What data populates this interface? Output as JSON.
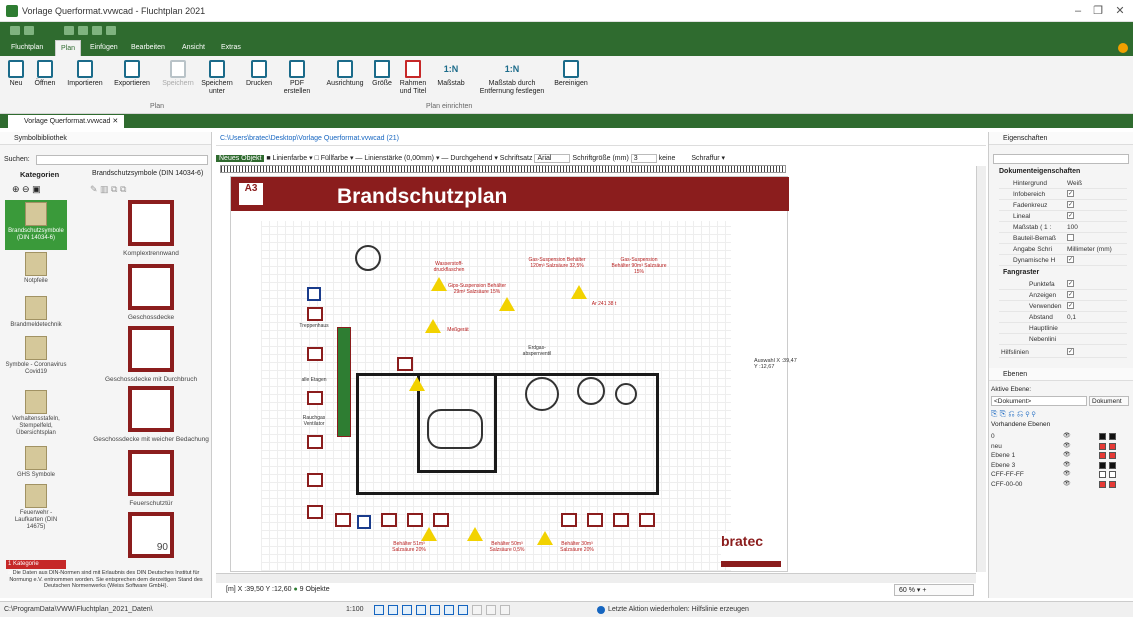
{
  "window": {
    "title": "Vorlage Querformat.vvwcad - Fluchtplan 2021"
  },
  "tabs": [
    "Fluchtplan",
    "Plan",
    "Einfügen",
    "Bearbeiten",
    "Ansicht",
    "Extras"
  ],
  "active_tab": "Plan",
  "ribbon": {
    "buttons": [
      "Neu",
      "Öffnen",
      "Importieren",
      "Exportieren",
      "Speichern",
      "Speichern unter",
      "Drucken",
      "PDF erstellen",
      "Ausrichtung",
      "Größe",
      "Rahmen und Titel",
      "Maßstab",
      "Maßstab durch Entfernung festlegen",
      "Bereinigen"
    ],
    "group_plan": "Plan",
    "group_einrichten": "Plan einrichten",
    "scale_icon": "1:N"
  },
  "doc_tab": "Vorlage Querformat.vvwcad",
  "left_panel": {
    "title": "Symbolbibliothek",
    "search_label": "Suchen:",
    "categories_header": "Kategorien",
    "symbols_header": "Brandschutzsymbole (DIN 14034-6)",
    "categories": [
      "Brandschutzsymbole (DIN 14034-6)",
      "Notpfeile",
      "Brandmeldetechnik",
      "Symbole - Coronavirus Covid19",
      "Verhaltensstafeln, Stempelfeld, Übersichtsplan",
      "GHS Symbole",
      "Feuerwehr - Laufkarten (DIN 14675)"
    ],
    "symbols": [
      "Komplextrennwand",
      "Geschossdecke",
      "Geschossdecke mit Durchbruch",
      "Geschossdecke mit weicher Bedachung",
      "Feuerschutztür",
      "Feuerschutztür"
    ],
    "symbol_last_number": "90",
    "category_note": "1 Kategorie ausgeblen...",
    "footer_note": "Die Daten aus DIN-Normen sind mit Erlaubnis des DIN Deutsches Institut für Normung e.V. entnommen worden. Sie entsprechen dem derzeitigen Stand des Deutschen Normenwerks (Weiss Software GmbH)."
  },
  "canvas": {
    "path": "C:\\Users\\bratec\\Desktop\\Vorlage Querformat.vvwcad (21)",
    "new_object": "Neues Objekt",
    "toolbar_items": [
      "Linienfarbe",
      "Füllfarbe",
      "Linienstärke (0,00mm)",
      "Durchgehend",
      "Schriftsatz",
      "Arial",
      "Schriftgröße (mm)",
      "3",
      "keine",
      "Schraffur"
    ],
    "plan_title": "Brandschutzplan",
    "paper_size": "A3",
    "labels": [
      "Wasserstoff-druckflaschen",
      "Gas-Suspension Behälter 120m³ Salzsäure 32,5%",
      "Gas-Suspension Behälter 90m³ Salzsäure 15%",
      "Gips-Suspension Behälter 29m³ Salzsäure 15%",
      "Ar 241 38 t",
      "Meßgerät",
      "Erdgas-absperrventil",
      "Treppenhaus",
      "alle Etagen",
      "Rauchgas Ventilator",
      "Behälter 51m³ Salzsäure 20%",
      "Behälter 50m³ Salzsäure 0,5%",
      "Behälter 30m³ Salzsäure 20%"
    ],
    "logo": "bratec",
    "side_label": "Auswahl X :39,47 Y :12,67",
    "coordinates": "[m] X :39,50 Y :12,60",
    "objects": "9 Objekte",
    "zoom": "60 %"
  },
  "right_panel": {
    "title": "Eigenschaften",
    "section": "Dokumenteigenschaften",
    "props": [
      {
        "k": "Hintergrund",
        "v": "Weiß"
      },
      {
        "k": "Infobereich",
        "v": "✓"
      },
      {
        "k": "Fadenkreuz",
        "v": "✓"
      },
      {
        "k": "Lineal",
        "v": "✓"
      },
      {
        "k": "Maßstab ( 1 :",
        "v": "100"
      },
      {
        "k": "Bauteil-Bemaß",
        "v": ""
      },
      {
        "k": "Angabe Schri",
        "v": "Millimeter (mm)"
      },
      {
        "k": "Dynamische H",
        "v": "✓"
      }
    ],
    "fangraster": "Fangraster",
    "fang_props": [
      {
        "k": "Punktefa",
        "v": "✓"
      },
      {
        "k": "Anzeigen",
        "v": "✓"
      },
      {
        "k": "Verwenden",
        "v": "✓"
      },
      {
        "k": "Abstand",
        "v": "0,1"
      },
      {
        "k": "Hauptlinie",
        "v": ""
      },
      {
        "k": "Nebenlini",
        "v": ""
      }
    ],
    "hilfslinien": "Hilfslinien",
    "layers_title": "Ebenen",
    "active_layer_label": "Aktive Ebene:",
    "active_layer": "<Dokument>",
    "active_layer_btn": "Dokument",
    "existing_layers": "Vorhandene Ebenen",
    "layers": [
      {
        "name": "0",
        "color": "#111111"
      },
      {
        "name": "neu",
        "color": "#e53935"
      },
      {
        "name": "Ebene 1",
        "color": "#e53935"
      },
      {
        "name": "Ebene 3",
        "color": "#111111"
      },
      {
        "name": "CFF-FF-FF",
        "color": "#ffffff"
      },
      {
        "name": "CFF-00-00",
        "color": "#e53935"
      }
    ]
  },
  "status": {
    "path": "C:\\ProgramData\\VWW\\Fluchtplan_2021_Daten\\",
    "scale": "1:100",
    "last_action": "Letzte Aktion wiederholen: Hilfslinie erzeugen"
  },
  "colors": {
    "accent": "#2f6b2f",
    "banner": "#8b1d1d",
    "icon": "#1b6b8a"
  }
}
